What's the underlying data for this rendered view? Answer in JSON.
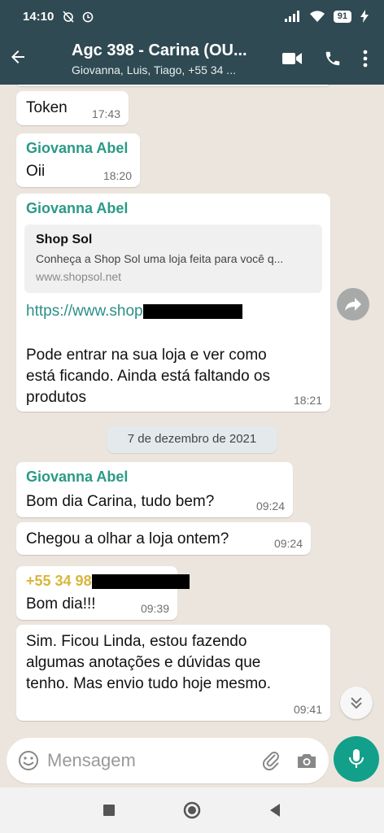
{
  "status": {
    "time": "14:10",
    "battery": "91"
  },
  "header": {
    "title": "Agc 398 - Carina (OU...",
    "subtitle": "Giovanna, Luis, Tiago, +55 34 ..."
  },
  "messages": {
    "m1": {
      "text": "Token",
      "time": "17:43"
    },
    "m2": {
      "sender": "Giovanna Abel",
      "text": "Oii",
      "time": "18:20"
    },
    "m3": {
      "sender": "Giovanna Abel",
      "preview_title": "Shop Sol",
      "preview_desc": "Conheça a Shop Sol uma loja feita para você q...",
      "preview_url": "www.shopsol.net",
      "link": "https://www.shop",
      "text1": "Pode entrar na sua loja e ver como",
      "text2": "está ficando. Ainda está faltando os",
      "text3": "produtos",
      "time": "18:21"
    },
    "date": "7 de dezembro de 2021",
    "m4": {
      "sender": "Giovanna Abel",
      "text": "Bom dia Carina, tudo bem?",
      "time": "09:24"
    },
    "m5": {
      "text": "Chegou a olhar a loja ontem?",
      "time": "09:24"
    },
    "m6": {
      "sender": "+55 34 98",
      "text": "Bom dia!!!",
      "time": "09:39"
    },
    "m7": {
      "text1": "Sim. Ficou Linda, estou fazendo",
      "text2": "algumas anotações e dúvidas que",
      "text3": "tenho. Mas envio tudo hoje mesmo.",
      "time": "09:41"
    }
  },
  "input": {
    "placeholder": "Mensagem"
  },
  "colors": {
    "header": "#2f4a52",
    "accent": "#13a08a",
    "sender": "#2a9a86",
    "background": "#ece5dd"
  },
  "icons": [
    "back-arrow-icon",
    "video-call-icon",
    "phone-icon",
    "more-options-icon",
    "forward-icon",
    "scroll-down-icon",
    "emoji-icon",
    "attach-icon",
    "camera-icon",
    "mic-icon"
  ]
}
